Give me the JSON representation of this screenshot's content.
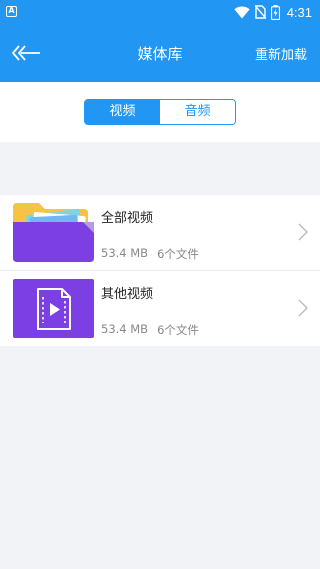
{
  "status_bar": {
    "left_icon_letter": "A",
    "time": "4:31",
    "icons": [
      "wifi-icon",
      "no-sim-icon",
      "battery-charging-icon"
    ]
  },
  "app_bar": {
    "back_icon": "back-arrow-icon",
    "title": "媒体库",
    "reload_label": "重新加载"
  },
  "tabs": [
    {
      "label": "视频",
      "active": true
    },
    {
      "label": "音频",
      "active": false
    }
  ],
  "folders": [
    {
      "name": "全部视频",
      "size": "53.4 MB",
      "count": "6个文件",
      "icon": "folder-icon"
    },
    {
      "name": "其他视频",
      "size": "53.4 MB",
      "count": "6个文件",
      "icon": "video-file-icon"
    }
  ],
  "colors": {
    "primary": "#2196f3",
    "purple": "#7b3fe4",
    "folder_yellow": "#f6c343",
    "background": "#f2f3f7"
  }
}
